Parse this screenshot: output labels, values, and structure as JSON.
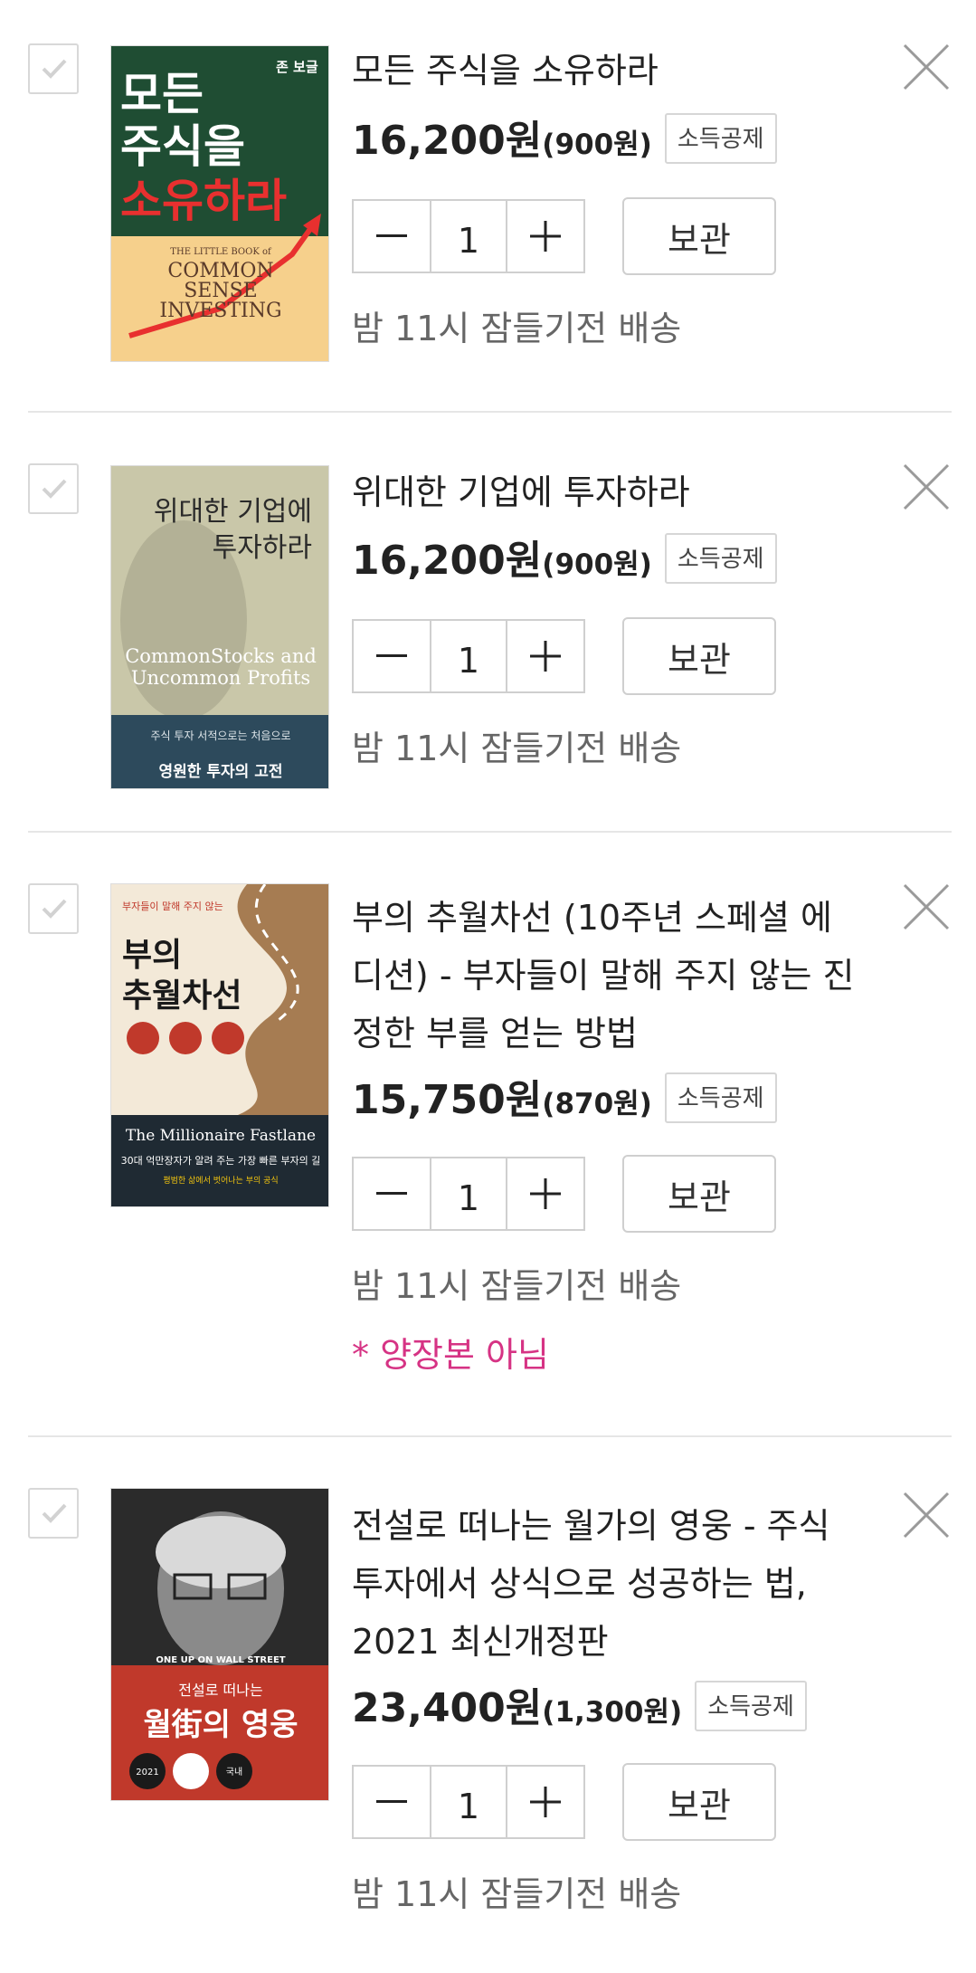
{
  "items": [
    {
      "title": "모든 주식을 소유하라",
      "price": "16,200원",
      "point": "(900원)",
      "tag": "소득공제",
      "qty": "1",
      "keep": "보관",
      "delivery": "밤 11시 잠들기전 배송",
      "cover": {
        "bg": "#1f4d33",
        "title": "모든 주식을 소유하라",
        "author": "존 보글",
        "en_title": "THE LITTLE BOOK of COMMON SENSE INVESTING"
      }
    },
    {
      "title": "위대한 기업에 투자하라",
      "price": "16,200원",
      "point": "(900원)",
      "tag": "소득공제",
      "qty": "1",
      "keep": "보관",
      "delivery": "밤 11시 잠들기전 배송",
      "cover": {
        "bg": "#c9c7a9",
        "title": "위대한 기업에 투자하라",
        "en_title": "Common Stocks and Uncommon Profits",
        "subtitle": "영원한 투자의 고전"
      }
    },
    {
      "title": "부의 추월차선 (10주년 스페셜 에디션) - 부자들이 말해 주지 않는 진정한 부를 얻는 방법",
      "price": "15,750원",
      "point": "(870원)",
      "tag": "소득공제",
      "qty": "1",
      "keep": "보관",
      "delivery": "밤 11시 잠들기전 배송",
      "note": "* 양장본 아님",
      "cover": {
        "bg": "#f3e9d8",
        "title": "부의 추월차선",
        "en_title": "The Millionaire Fastlane"
      }
    },
    {
      "title": "전설로 떠나는 월가의 영웅 - 주식투자에서 상식으로 성공하는 법, 2021 최신개정판",
      "price": "23,400원",
      "point": "(1,300원)",
      "tag": "소득공제",
      "qty": "1",
      "keep": "보관",
      "delivery": "밤 11시 잠들기전 배송",
      "cover": {
        "bg": "#c0392b",
        "title": "전설로 떠나는 월街의 영웅",
        "en_title": "ONE UP ON WALL STREET"
      }
    }
  ],
  "colors": {
    "note": "#d63384",
    "divider": "#e6e6e6",
    "border": "#cfcfcf"
  },
  "icons": {
    "minus": "minus-icon",
    "plus": "plus-icon",
    "close": "close-icon",
    "check": "checkmark-icon"
  }
}
